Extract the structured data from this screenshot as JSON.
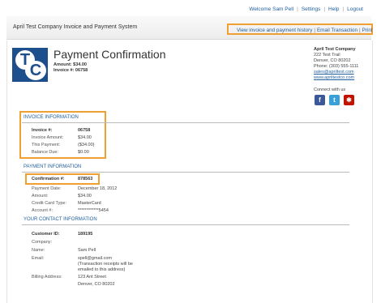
{
  "topnav": {
    "welcome": "Welcome Sam Pell",
    "settings": "Settings",
    "help": "Help",
    "logout": "Logout"
  },
  "header": {
    "title": "April Test Company  Invoice and Payment System"
  },
  "actions": {
    "history": "View invoice and payment history",
    "email": "Email Transaction",
    "print": "Print"
  },
  "logo": {
    "letter1": "T",
    "letter2": "C",
    "color": "#1d4f8c"
  },
  "page": {
    "title": "Payment Confirmation",
    "amount_line": "Amount: $34.00",
    "invoice_line": "Invoice #: 06758"
  },
  "company": {
    "name": "April Test Company",
    "street": "222 Test Trail",
    "city": "Denver, CO 80202",
    "phone": "Phone: (303) 555-1111",
    "email": "sales@apriltest.com",
    "web": "www.apriltestco.com",
    "connect": "Connect with us",
    "social": [
      "facebook-icon",
      "twitter-icon",
      "yelp-icon"
    ]
  },
  "invoice_info": {
    "title": "INVOICE INFORMATION",
    "rows": [
      {
        "label": "Invoice #:",
        "value": "06758"
      },
      {
        "label": "Invoice Amount:",
        "value": "$34.00"
      },
      {
        "label": "This Payment:",
        "value": "($34.00)"
      },
      {
        "label": "Balance Due:",
        "value": "$0.00"
      }
    ]
  },
  "payment_info": {
    "title": "PAYMENT INFORMATION",
    "rows": [
      {
        "label": "Confirmation #:",
        "value": "878563"
      },
      {
        "label": "Payment Date:",
        "value": "December 18, 2012"
      },
      {
        "label": "Amount:",
        "value": "$34.00"
      },
      {
        "label": "Credit Card Type:",
        "value": "MasterCard"
      },
      {
        "label": "Account #:",
        "value": "************5454"
      }
    ]
  },
  "contact_info": {
    "title": "YOUR CONTACT INFORMATION",
    "rows": [
      {
        "label": "Customer ID:",
        "value": "189195"
      },
      {
        "label": "Company:",
        "value": ""
      },
      {
        "label": "Name:",
        "value": "Sam Pell"
      },
      {
        "label": "Email:",
        "value": "spell@gmail.com"
      },
      {
        "label": "",
        "value": "(Transaction receipts will be"
      },
      {
        "label": "",
        "value": "emailed to this address)"
      },
      {
        "label": "Billing Address:",
        "value": "123 Ant Street"
      },
      {
        "label": "",
        "value": "Denver, CO 80202"
      }
    ]
  }
}
